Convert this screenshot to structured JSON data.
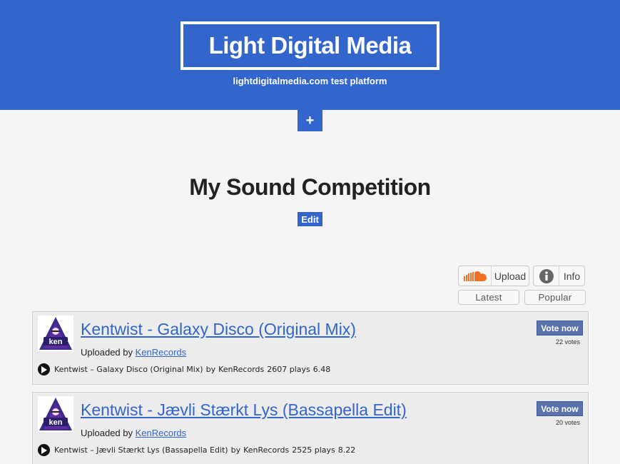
{
  "header": {
    "logo": "Light Digital Media",
    "tagline": "lightdigitalmedia.com test platform",
    "plus_label": "+"
  },
  "page": {
    "title": "My Sound Competition",
    "edit_label": "Edit"
  },
  "toolbar": {
    "upload_label": "Upload",
    "upload_icon": "soundcloud-icon",
    "info_label": "Info",
    "info_icon": "info-circle-icon",
    "sort_latest": "Latest",
    "sort_popular": "Popular"
  },
  "colors": {
    "brand": "#3366cc",
    "vote_button": "#5b73ac",
    "soundcloud": "#f26f23"
  },
  "entries": [
    {
      "title": "Kentwist - Galaxy Disco (Original Mix)",
      "uploaded_by": "Uploaded by",
      "uploader": "KenRecords",
      "vote_label": "Vote now",
      "votes": "22 votes",
      "player_track": "Kentwist – Galaxy Disco (Original Mix)",
      "player_by": "by",
      "player_artist": "KenRecords",
      "plays": "2607 plays",
      "score": "6.48"
    },
    {
      "title": "Kentwist - Jævli Stærkt Lys (Bassapella Edit)",
      "uploaded_by": "Uploaded by",
      "uploader": "KenRecords",
      "vote_label": "Vote now",
      "votes": "20 votes",
      "player_track": "Kentwist – Jævli Stærkt Lys (Bassapella Edit)",
      "player_by": "by",
      "player_artist": "KenRecords",
      "plays": "2525 plays",
      "score": "8.22"
    }
  ]
}
